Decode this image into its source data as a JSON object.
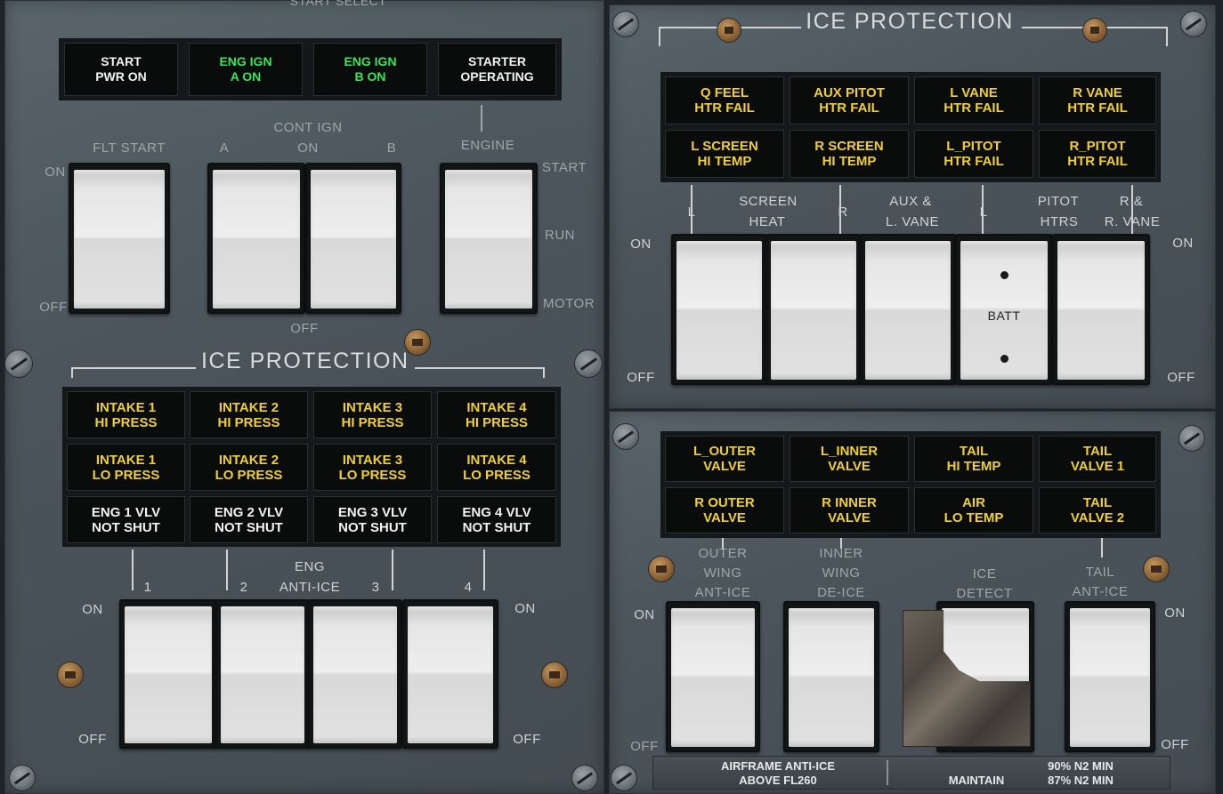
{
  "left_panel": {
    "top_cut_label": "START SELECT",
    "start_annunciators": [
      {
        "line1": "START",
        "line2": "PWR ON",
        "color": "white"
      },
      {
        "line1": "ENG IGN",
        "line2": "A ON",
        "color": "green"
      },
      {
        "line1": "ENG IGN",
        "line2": "B ON",
        "color": "green"
      },
      {
        "line1": "STARTER",
        "line2": "OPERATING",
        "color": "white"
      }
    ],
    "labels": {
      "cont_ign": "CONT IGN",
      "flt_start": "FLT START",
      "a": "A",
      "on_mid": "ON",
      "b": "B",
      "engine": "ENGINE",
      "start": "START",
      "run": "RUN",
      "motor": "MOTOR",
      "on_left": "ON",
      "off_left": "OFF",
      "off_mid": "OFF"
    },
    "ice_protection_title": "ICE PROTECTION",
    "intake_annunciators": [
      [
        {
          "line1": "INTAKE 1",
          "line2": "HI PRESS",
          "color": "amber"
        },
        {
          "line1": "INTAKE 2",
          "line2": "HI PRESS",
          "color": "amber"
        },
        {
          "line1": "INTAKE 3",
          "line2": "HI PRESS",
          "color": "amber"
        },
        {
          "line1": "INTAKE 4",
          "line2": "HI PRESS",
          "color": "amber"
        }
      ],
      [
        {
          "line1": "INTAKE 1",
          "line2": "LO PRESS",
          "color": "amber"
        },
        {
          "line1": "INTAKE 2",
          "line2": "LO PRESS",
          "color": "amber"
        },
        {
          "line1": "INTAKE 3",
          "line2": "LO PRESS",
          "color": "amber"
        },
        {
          "line1": "INTAKE 4",
          "line2": "LO PRESS",
          "color": "amber"
        }
      ],
      [
        {
          "line1": "ENG 1 VLV",
          "line2": "NOT SHUT",
          "color": "white"
        },
        {
          "line1": "ENG 2 VLV",
          "line2": "NOT SHUT",
          "color": "white"
        },
        {
          "line1": "ENG 3 VLV",
          "line2": "NOT SHUT",
          "color": "white"
        },
        {
          "line1": "ENG 4 VLV",
          "line2": "NOT SHUT",
          "color": "white"
        }
      ]
    ],
    "eng_anti_ice": {
      "title_line1": "ENG",
      "title_line2": "ANTI-ICE",
      "n1": "1",
      "n2": "2",
      "n3": "3",
      "n4": "4",
      "on_left": "ON",
      "on_right": "ON",
      "off_left": "OFF",
      "off_right": "OFF"
    }
  },
  "right_panel": {
    "ice_protection_title": "ICE PROTECTION",
    "upper_annunciators": [
      [
        {
          "line1": "Q FEEL",
          "line2": "HTR FAIL",
          "color": "amber"
        },
        {
          "line1": "AUX PITOT",
          "line2": "HTR FAIL",
          "color": "amber"
        },
        {
          "line1": "L VANE",
          "line2": "HTR FAIL",
          "color": "amber"
        },
        {
          "line1": "R VANE",
          "line2": "HTR FAIL",
          "color": "amber"
        }
      ],
      [
        {
          "line1": "L SCREEN",
          "line2": "HI TEMP",
          "color": "amber"
        },
        {
          "line1": "R SCREEN",
          "line2": "HI TEMP",
          "color": "amber"
        },
        {
          "line1": "L_PITOT",
          "line2": "HTR FAIL",
          "color": "amber"
        },
        {
          "line1": "R_PITOT",
          "line2": "HTR FAIL",
          "color": "amber"
        }
      ]
    ],
    "heat_labels": {
      "l1": "L",
      "screen": "SCREEN",
      "heat": "HEAT",
      "r1": "R",
      "aux": "AUX &",
      "lvane": "L. VANE",
      "l2": "L",
      "pitot": "PITOT",
      "htrs": "HTRS",
      "r_amp": "R &",
      "rvane": "R. VANE",
      "on_left": "ON",
      "on_right": "ON",
      "off_left": "OFF",
      "off_right": "OFF",
      "batt": "BATT"
    },
    "lower_annunciators": [
      [
        {
          "line1": "L_OUTER",
          "line2": "VALVE",
          "color": "amber"
        },
        {
          "line1": "L_INNER",
          "line2": "VALVE",
          "color": "amber"
        },
        {
          "line1": "TAIL",
          "line2": "HI TEMP",
          "color": "amber"
        },
        {
          "line1": "TAIL",
          "line2": "VALVE 1",
          "color": "amber"
        }
      ],
      [
        {
          "line1": "R OUTER",
          "line2": "VALVE",
          "color": "amber"
        },
        {
          "line1": "R INNER",
          "line2": "VALVE",
          "color": "amber"
        },
        {
          "line1": "AIR",
          "line2": "LO TEMP",
          "color": "amber"
        },
        {
          "line1": "TAIL",
          "line2": "VALVE 2",
          "color": "amber"
        }
      ]
    ],
    "airframe_labels": {
      "outer1": "OUTER",
      "outer2": "WING",
      "outer3": "ANT-ICE",
      "inner1": "INNER",
      "inner2": "WING",
      "inner3": "DE-ICE",
      "ice1": "ICE",
      "ice2": "DETECT",
      "tail1": "TAIL",
      "tail2": "ANT-!CE",
      "on_left": "ON",
      "on_right": "ON",
      "off_left": "OFF",
      "off_right": "OFF"
    },
    "placard": {
      "line1": "AIRFRAME ANTI-ICE",
      "line2": "ABOVE FL260",
      "maintain": "MAINTAIN",
      "n2_a": "90% N2 MIN",
      "n2_b": "87% N2 MIN"
    }
  },
  "colors": {
    "amber": "#f0d030",
    "white": "#f2f2f2",
    "green": "#39e65a",
    "panel": "#4f595f"
  }
}
